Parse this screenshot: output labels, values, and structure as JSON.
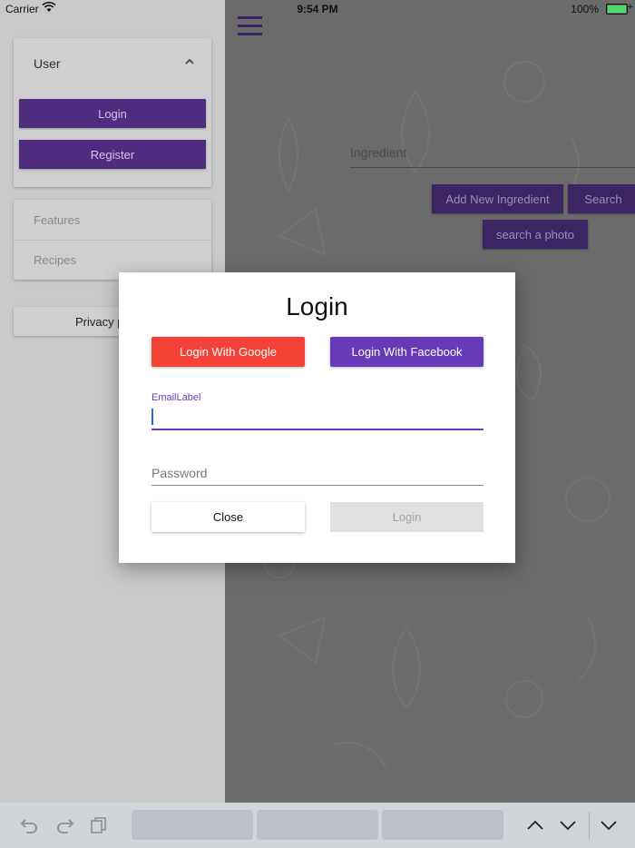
{
  "status_bar": {
    "carrier": "Carrier",
    "time": "9:54 PM",
    "battery": "100%",
    "battery_level": 1.0
  },
  "drawer": {
    "user_section": {
      "title": "User",
      "login_label": "Login",
      "register_label": "Register"
    },
    "nav_items": [
      {
        "label": "Features"
      },
      {
        "label": "Recipes"
      }
    ],
    "privacy_label": "Privacy p"
  },
  "main": {
    "ingredient_placeholder": "Ingredient",
    "add_ingredient_label": "Add New Ingredient",
    "search_label": "Search",
    "search_photo_label": "search a photo"
  },
  "dialog": {
    "title": "Login",
    "google_label": "Login With Google",
    "facebook_label": "Login With Facebook",
    "email_label": "EmailLabel",
    "email_value": "",
    "password_placeholder": "Password",
    "close_label": "Close",
    "login_label": "Login"
  },
  "colors": {
    "primary": "#673ab7",
    "google": "#f44336",
    "facebook": "#673ab7",
    "drawer_button": "#4e2d80"
  },
  "icons": {
    "menu": "hamburger-icon",
    "collapse": "chevron-up-icon",
    "undo": "undo-icon",
    "redo": "redo-icon",
    "paste": "clipboard-icon",
    "prev_field": "chevron-up-icon",
    "next_field": "chevron-down-icon",
    "dismiss_keyboard": "chevron-down-icon"
  }
}
